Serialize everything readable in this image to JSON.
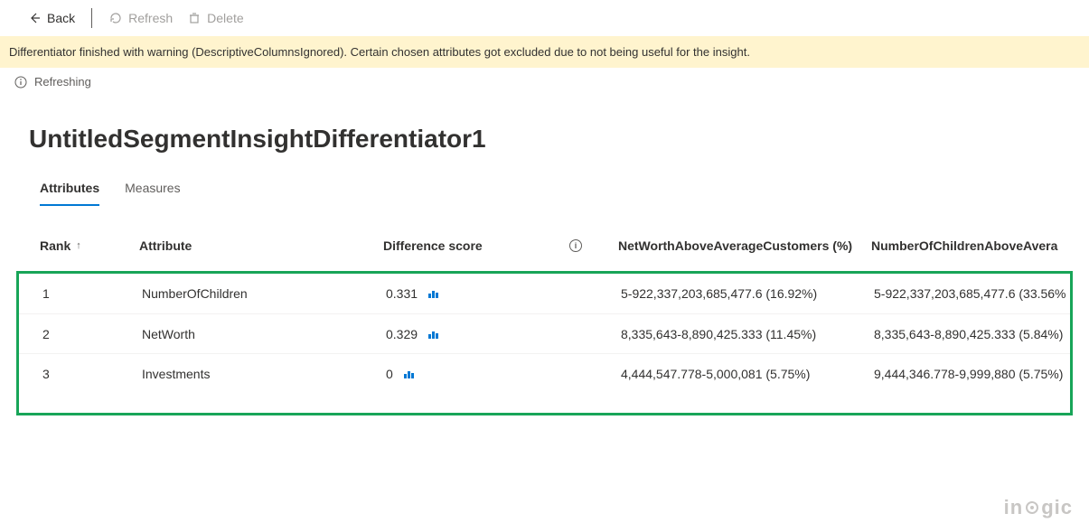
{
  "toolbar": {
    "back_label": "Back",
    "refresh_label": "Refresh",
    "delete_label": "Delete"
  },
  "banner": {
    "message": "Differentiator finished with warning (DescriptiveColumnsIgnored). Certain chosen attributes got excluded due to not being useful for the insight."
  },
  "status": {
    "text": "Refreshing"
  },
  "page": {
    "title": "UntitledSegmentInsightDifferentiator1"
  },
  "tabs": {
    "attributes": "Attributes",
    "measures": "Measures"
  },
  "table": {
    "headers": {
      "rank": "Rank",
      "attribute": "Attribute",
      "diff_score": "Difference score",
      "col_a": "NetWorthAboveAverageCustomers (%)",
      "col_b": "NumberOfChildrenAboveAvera"
    },
    "rows": [
      {
        "rank": "1",
        "attribute": "NumberOfChildren",
        "diff": "0.331",
        "colA": "5-922,337,203,685,477.6 (16.92%)",
        "colB": "5-922,337,203,685,477.6 (33.56%"
      },
      {
        "rank": "2",
        "attribute": "NetWorth",
        "diff": "0.329",
        "colA": "8,335,643-8,890,425.333 (11.45%)",
        "colB": "8,335,643-8,890,425.333 (5.84%)"
      },
      {
        "rank": "3",
        "attribute": "Investments",
        "diff": "0",
        "colA": "4,444,547.778-5,000,081 (5.75%)",
        "colB": "9,444,346.778-9,999,880 (5.75%)"
      }
    ]
  },
  "watermark": {
    "part1": "in",
    "part2": "gic"
  }
}
